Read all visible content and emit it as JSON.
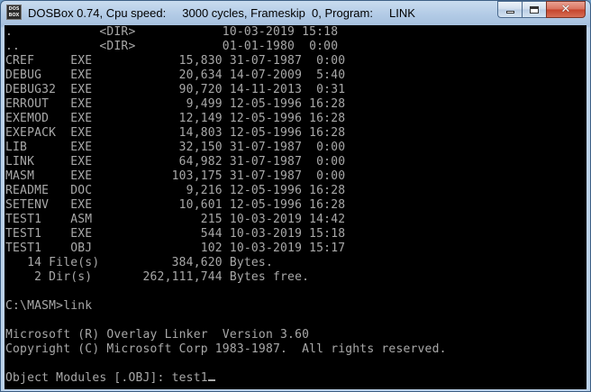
{
  "window": {
    "title": "DOSBox 0.74, Cpu speed:     3000 cycles, Frameskip  0, Program:     LINK",
    "icon_top": "DOS",
    "icon_bottom": "BOX"
  },
  "console": {
    "lines": [
      ".            <DIR>            10-03-2019 15:18",
      "..           <DIR>            01-01-1980  0:00",
      "CREF     EXE            15,830 31-07-1987  0:00",
      "DEBUG    EXE            20,634 14-07-2009  5:40",
      "DEBUG32  EXE            90,720 14-11-2013  0:31",
      "ERROUT   EXE             9,499 12-05-1996 16:28",
      "EXEMOD   EXE            12,149 12-05-1996 16:28",
      "EXEPACK  EXE            14,803 12-05-1996 16:28",
      "LIB      EXE            32,150 31-07-1987  0:00",
      "LINK     EXE            64,982 31-07-1987  0:00",
      "MASM     EXE           103,175 31-07-1987  0:00",
      "README   DOC             9,216 12-05-1996 16:28",
      "SETENV   EXE            10,601 12-05-1996 16:28",
      "TEST1    ASM               215 10-03-2019 14:42",
      "TEST1    EXE               544 10-03-2019 15:18",
      "TEST1    OBJ               102 10-03-2019 15:17",
      "   14 File(s)          384,620 Bytes.",
      "    2 Dir(s)       262,111,744 Bytes free.",
      "",
      "C:\\MASM>link",
      "",
      "Microsoft (R) Overlay Linker  Version 3.60",
      "Copyright (C) Microsoft Corp 1983-1987.  All rights reserved.",
      "",
      "Object Modules [.OBJ]: test1"
    ]
  },
  "colors": {
    "console_text": "#a8a8a8",
    "console_bg": "#000000"
  }
}
